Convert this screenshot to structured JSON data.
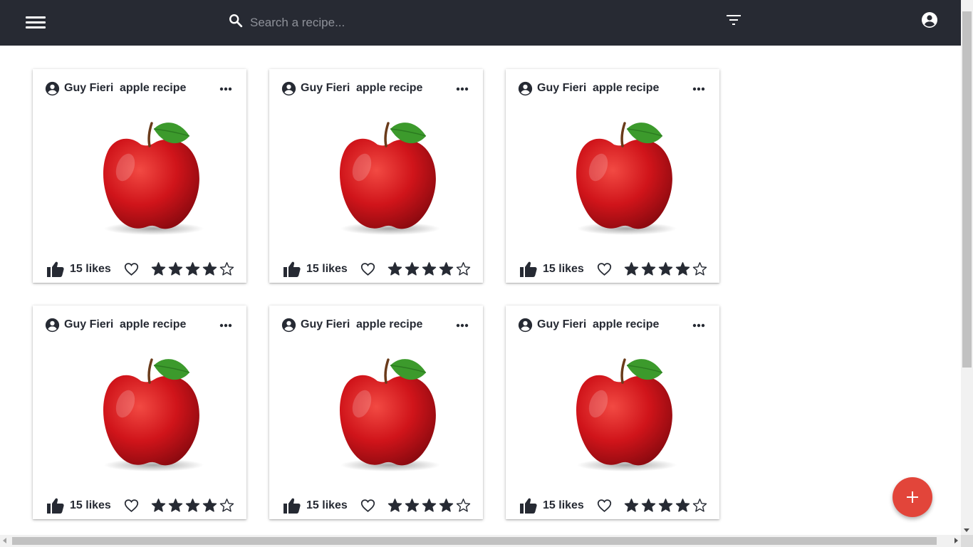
{
  "topbar": {
    "menu_icon": "hamburger-menu-icon",
    "search_icon": "search-icon",
    "search_placeholder": "Search a recipe...",
    "filter_icon": "filter-icon",
    "account_icon": "account-circle-icon",
    "background": "#272a33"
  },
  "cards": [
    {
      "author": "Guy Fieri",
      "title": "apple recipe",
      "likes_text": "15 likes",
      "rating": 4,
      "max_rating": 5,
      "favorited": false,
      "image": "red-apple-image"
    },
    {
      "author": "Guy Fieri",
      "title": "apple recipe",
      "likes_text": "15 likes",
      "rating": 4,
      "max_rating": 5,
      "favorited": false,
      "image": "red-apple-image"
    },
    {
      "author": "Guy Fieri",
      "title": "apple recipe",
      "likes_text": "15 likes",
      "rating": 4,
      "max_rating": 5,
      "favorited": false,
      "image": "red-apple-image"
    },
    {
      "author": "Guy Fieri",
      "title": "apple recipe",
      "likes_text": "15 likes",
      "rating": 4,
      "max_rating": 5,
      "favorited": false,
      "image": "red-apple-image"
    },
    {
      "author": "Guy Fieri",
      "title": "apple recipe",
      "likes_text": "15 likes",
      "rating": 4,
      "max_rating": 5,
      "favorited": false,
      "image": "red-apple-image"
    },
    {
      "author": "Guy Fieri",
      "title": "apple recipe",
      "likes_text": "15 likes",
      "rating": 4,
      "max_rating": 5,
      "favorited": false,
      "image": "red-apple-image"
    }
  ],
  "fab": {
    "icon": "plus-icon",
    "color": "#e2453a"
  },
  "colors": {
    "text": "#262a33",
    "page_background": "#ffffff"
  }
}
